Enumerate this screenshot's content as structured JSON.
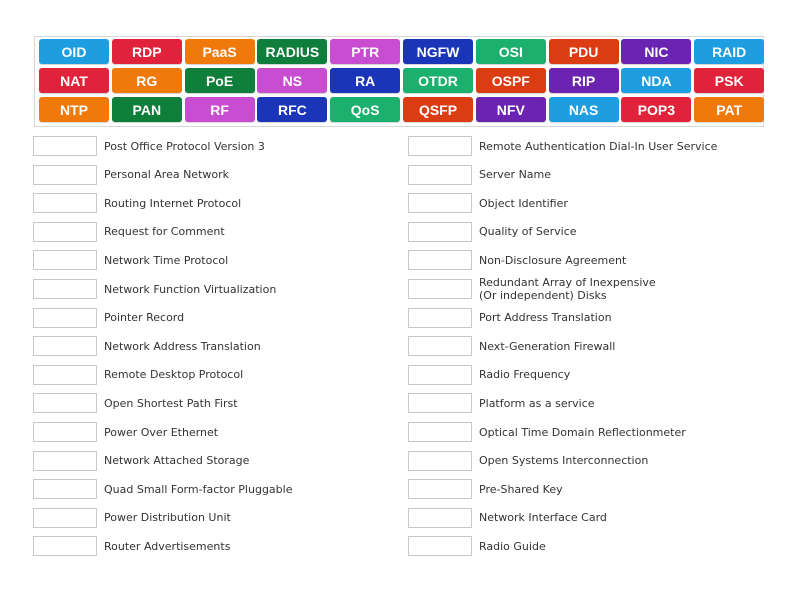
{
  "colors": {
    "blue": "#1e9ee0",
    "red": "#e0223b",
    "orange": "#f0790b",
    "green": "#0e7e3a",
    "pink": "#c84dd0",
    "navy": "#1a35b8",
    "teal": "#1cb06e",
    "darkorange": "#dc3c12",
    "purple": "#6b24b2"
  },
  "tiles": [
    [
      {
        "label": "OID",
        "color": "blue"
      },
      {
        "label": "RDP",
        "color": "red"
      },
      {
        "label": "PaaS",
        "color": "orange"
      },
      {
        "label": "RADIUS",
        "color": "green"
      },
      {
        "label": "PTR",
        "color": "pink"
      },
      {
        "label": "NGFW",
        "color": "navy"
      },
      {
        "label": "OSI",
        "color": "teal"
      },
      {
        "label": "PDU",
        "color": "darkorange"
      },
      {
        "label": "NIC",
        "color": "purple"
      },
      {
        "label": "RAID",
        "color": "blue"
      }
    ],
    [
      {
        "label": "NAT",
        "color": "red"
      },
      {
        "label": "RG",
        "color": "orange"
      },
      {
        "label": "PoE",
        "color": "green"
      },
      {
        "label": "NS",
        "color": "pink"
      },
      {
        "label": "RA",
        "color": "navy"
      },
      {
        "label": "OTDR",
        "color": "teal"
      },
      {
        "label": "OSPF",
        "color": "darkorange"
      },
      {
        "label": "RIP",
        "color": "purple"
      },
      {
        "label": "NDA",
        "color": "blue"
      },
      {
        "label": "PSK",
        "color": "red"
      }
    ],
    [
      {
        "label": "NTP",
        "color": "orange"
      },
      {
        "label": "PAN",
        "color": "green"
      },
      {
        "label": "RF",
        "color": "pink"
      },
      {
        "label": "RFC",
        "color": "navy"
      },
      {
        "label": "QoS",
        "color": "teal"
      },
      {
        "label": "QSFP",
        "color": "darkorange"
      },
      {
        "label": "NFV",
        "color": "purple"
      },
      {
        "label": "NAS",
        "color": "blue"
      },
      {
        "label": "POP3",
        "color": "red"
      },
      {
        "label": "PAT",
        "color": "orange"
      }
    ]
  ],
  "left_definitions": [
    "Post Office Protocol Version 3",
    "Personal Area Network",
    "Routing Internet Protocol",
    "Request for Comment",
    "Network Time Protocol",
    "Network Function Virtualization",
    "Pointer Record",
    "Network Address Translation",
    "Remote Desktop Protocol",
    "Open Shortest Path First",
    "Power Over Ethernet",
    "Network Attached Storage",
    "Quad Small Form-factor Pluggable",
    "Power Distribution Unit",
    "Router Advertisements"
  ],
  "right_definitions": [
    "Remote Authentication Dial-In User Service",
    "Server Name",
    "Object Identifier",
    "Quality of Service",
    "Non-Disclosure Agreement",
    "Redundant Array of Inexpensive\n(Or independent) Disks",
    "Port Address Translation",
    "Next-Generation Firewall",
    "Radio Frequency",
    "Platform as a service",
    "Optical Time Domain Reflectionmeter",
    "Open Systems Interconnection",
    "Pre-Shared Key",
    "Network Interface Card",
    "Radio Guide"
  ]
}
